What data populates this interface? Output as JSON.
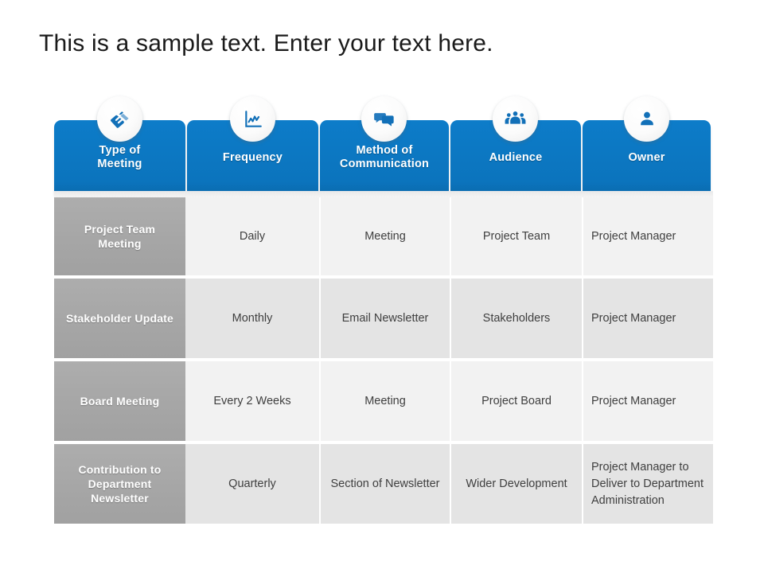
{
  "slide": {
    "title": "This is a sample text. Enter your text here.",
    "accent_color": "#0d7cc9",
    "label_color": "#a8a8a8",
    "row_light": "#f2f2f2",
    "row_dark": "#e4e4e4"
  },
  "table": {
    "columns": [
      {
        "label": "Type of\nMeeting",
        "label_line1": "Type of",
        "label_line2": "Meeting",
        "icon": "handshake-icon"
      },
      {
        "label": "Frequency",
        "label_line1": "Frequency",
        "label_line2": "",
        "icon": "line-chart-icon"
      },
      {
        "label": "Method of\nCommunication",
        "label_line1": "Method of",
        "label_line2": "Communication",
        "icon": "chat-bubbles-icon"
      },
      {
        "label": "Audience",
        "label_line1": "Audience",
        "label_line2": "",
        "icon": "people-group-icon"
      },
      {
        "label": "Owner",
        "label_line1": "Owner",
        "label_line2": "",
        "icon": "person-icon"
      }
    ],
    "rows": [
      {
        "type_of_meeting": "Project Team Meeting",
        "frequency": "Daily",
        "method_of_communication": "Meeting",
        "audience": "Project Team",
        "owner": "Project Manager"
      },
      {
        "type_of_meeting": "Stakeholder Update",
        "frequency": "Monthly",
        "method_of_communication": "Email Newsletter",
        "audience": "Stakeholders",
        "owner": "Project Manager"
      },
      {
        "type_of_meeting": "Board Meeting",
        "frequency": "Every 2 Weeks",
        "method_of_communication": "Meeting",
        "audience": "Project Board",
        "owner": "Project Manager"
      },
      {
        "type_of_meeting": "Contribution to Department Newsletter",
        "frequency": "Quarterly",
        "method_of_communication": "Section of Newsletter",
        "audience": "Wider Development",
        "owner": "Project Manager to Deliver to Department Administration"
      }
    ]
  }
}
